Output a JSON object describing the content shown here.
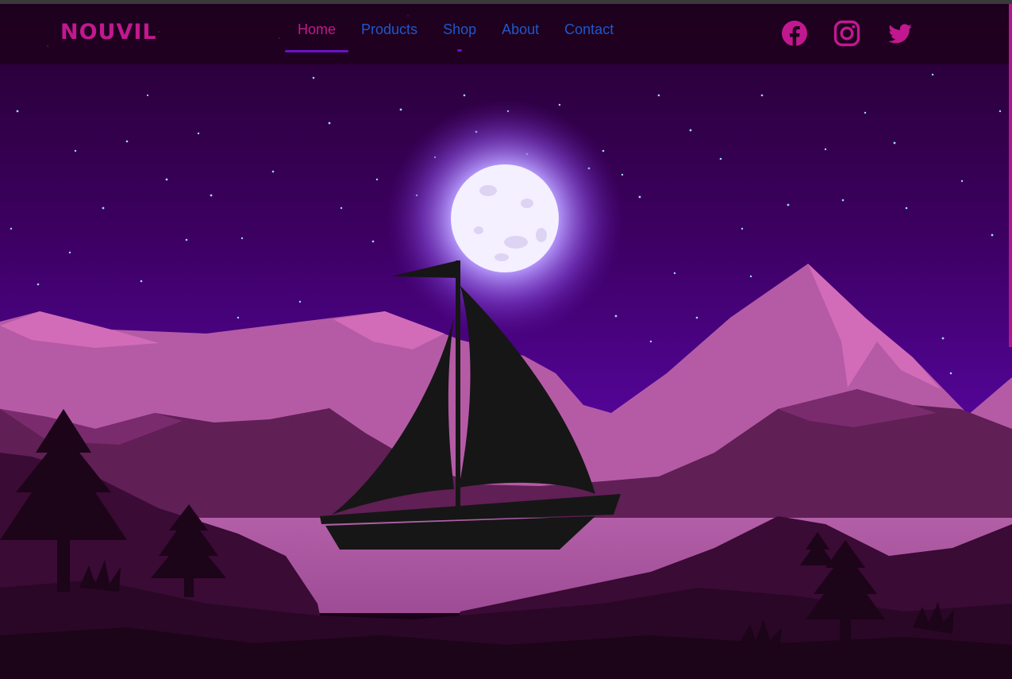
{
  "brand": {
    "name": "NOUVIL"
  },
  "nav": {
    "links": [
      {
        "label": "Home",
        "active": true
      },
      {
        "label": "Products",
        "active": false
      },
      {
        "label": "Shop",
        "active": false
      },
      {
        "label": "About",
        "active": false
      },
      {
        "label": "Contact",
        "active": false
      }
    ]
  },
  "social": {
    "icons": [
      "facebook-icon",
      "instagram-icon",
      "twitter-icon"
    ]
  },
  "hero": {
    "scene": [
      "moon",
      "stars",
      "mountains",
      "lake",
      "sailboat",
      "pine-trees"
    ]
  },
  "colors": {
    "accent": "#c2188f",
    "link": "#1f57c9",
    "active_underline": "#6a12c8",
    "sky_top": "#25002e",
    "sky_bottom": "#5a06a8",
    "mountain_light": "#c866b0",
    "lake": "#a8559e",
    "silhouette": "#161616"
  }
}
